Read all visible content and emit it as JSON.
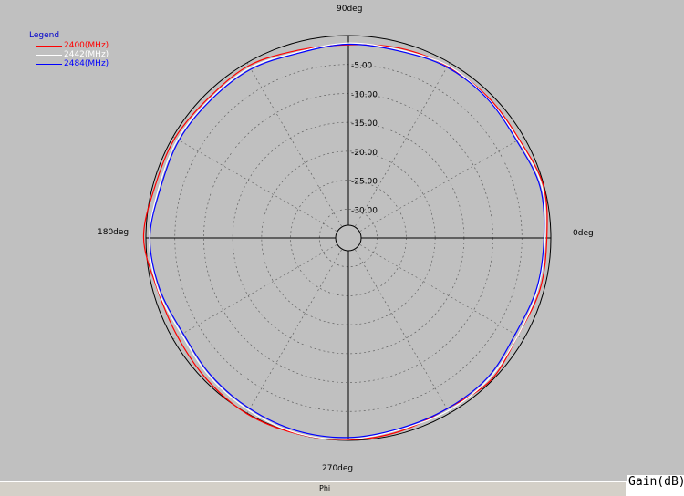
{
  "chart_data": {
    "type": "polar-line",
    "angle_labels": [
      "90deg",
      "180deg",
      "0deg",
      "270deg"
    ],
    "radial_ticks": [
      "-5.00",
      "-10.00",
      "-15.00",
      "-20.00",
      "-25.00",
      "-30.00"
    ],
    "radial_range": [
      -35,
      0
    ],
    "angular_range": [
      0,
      360
    ],
    "legend_title": "Legend",
    "legend_placement": "top-left",
    "x_axis_label": "Phi",
    "units_label": "Gain(dB)",
    "series": [
      {
        "name": "2400(MHz)",
        "color": "#ff0000",
        "angle": [
          0,
          15,
          30,
          45,
          60,
          75,
          90,
          105,
          120,
          135,
          150,
          165,
          180,
          195,
          210,
          225,
          240,
          255,
          270,
          285,
          300,
          315,
          330,
          345,
          360
        ],
        "gain": [
          -0.7,
          -0.1,
          -0.9,
          -0.7,
          -0.7,
          -1.0,
          -1.6,
          -1.4,
          -0.6,
          -0.8,
          -0.4,
          -0.4,
          0.4,
          -0.8,
          -0.9,
          -0.4,
          0.1,
          0.0,
          -0.1,
          -0.4,
          -0.9,
          -0.2,
          -1.2,
          -0.7,
          -0.7
        ]
      },
      {
        "name": "2442(MHz)",
        "color": "#ffffff",
        "angle": [
          0,
          15,
          30,
          45,
          60,
          75,
          90,
          105,
          120,
          135,
          150,
          165,
          180,
          195,
          210,
          225,
          240,
          255,
          270,
          285,
          300,
          315,
          330,
          345,
          360
        ],
        "gain": [
          -1.0,
          -0.4,
          -1.1,
          -0.9,
          -0.6,
          -1.3,
          -1.3,
          -1.7,
          -1.0,
          -1.1,
          -0.9,
          -1.1,
          -0.6,
          -0.9,
          -1.7,
          -1.1,
          -0.6,
          -0.1,
          -0.2,
          -0.7,
          -0.5,
          -0.6,
          -1.2,
          -1.1,
          -1.0
        ]
      },
      {
        "name": "2484(MHz)",
        "color": "#0000ff",
        "angle": [
          0,
          15,
          30,
          45,
          60,
          75,
          90,
          105,
          120,
          135,
          150,
          165,
          180,
          195,
          210,
          225,
          240,
          255,
          270,
          285,
          300,
          315,
          330,
          345,
          360
        ],
        "gain": [
          -1.2,
          -0.7,
          -1.4,
          -1.0,
          -0.9,
          -1.5,
          -1.5,
          -1.9,
          -1.3,
          -1.3,
          -1.2,
          -1.4,
          -0.7,
          -1.2,
          -2.0,
          -1.4,
          -0.9,
          -0.5,
          -0.5,
          -0.9,
          -0.9,
          -0.9,
          -1.7,
          -1.3,
          -1.2
        ]
      }
    ]
  }
}
